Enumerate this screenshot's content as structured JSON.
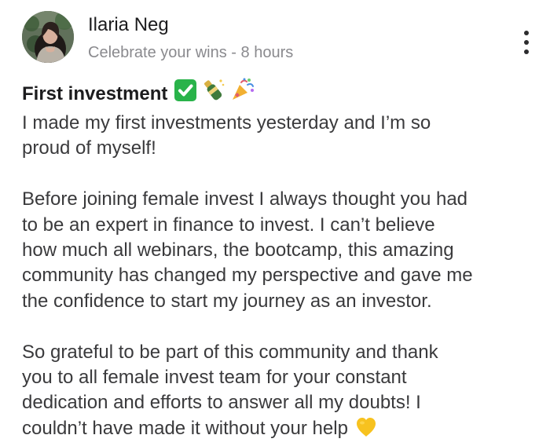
{
  "post": {
    "author": "Ilaria Neg",
    "meta": "Celebrate your wins - 8 hours",
    "title": "First investment",
    "title_emojis": [
      "check-mark-emoji",
      "champagne-emoji",
      "party-popper-emoji"
    ],
    "paragraphs": [
      [
        "I made my first investments yesterday and I’m so",
        "proud of myself!"
      ],
      [
        "Before joining female invest I always thought you had",
        "to be an expert in finance to invest. I can’t believe",
        "how much all webinars, the bootcamp, this amazing",
        "community has changed my perspective and gave me",
        "the confidence to start my journey as an investor."
      ],
      [
        "So grateful to be part of this community and thank",
        "you to all female invest team for your constant",
        "dedication and efforts to answer all my doubts! I",
        "couldn’t have made it without your help"
      ]
    ]
  },
  "icons": {
    "more": "vertical-more-icon",
    "end_emoji": "yellow-heart-emoji"
  },
  "colors": {
    "text": "#3a3a3c",
    "title": "#1c1c1e",
    "meta": "#8a8a8e",
    "check": "#29b34a",
    "heart": "#f7c21f"
  }
}
